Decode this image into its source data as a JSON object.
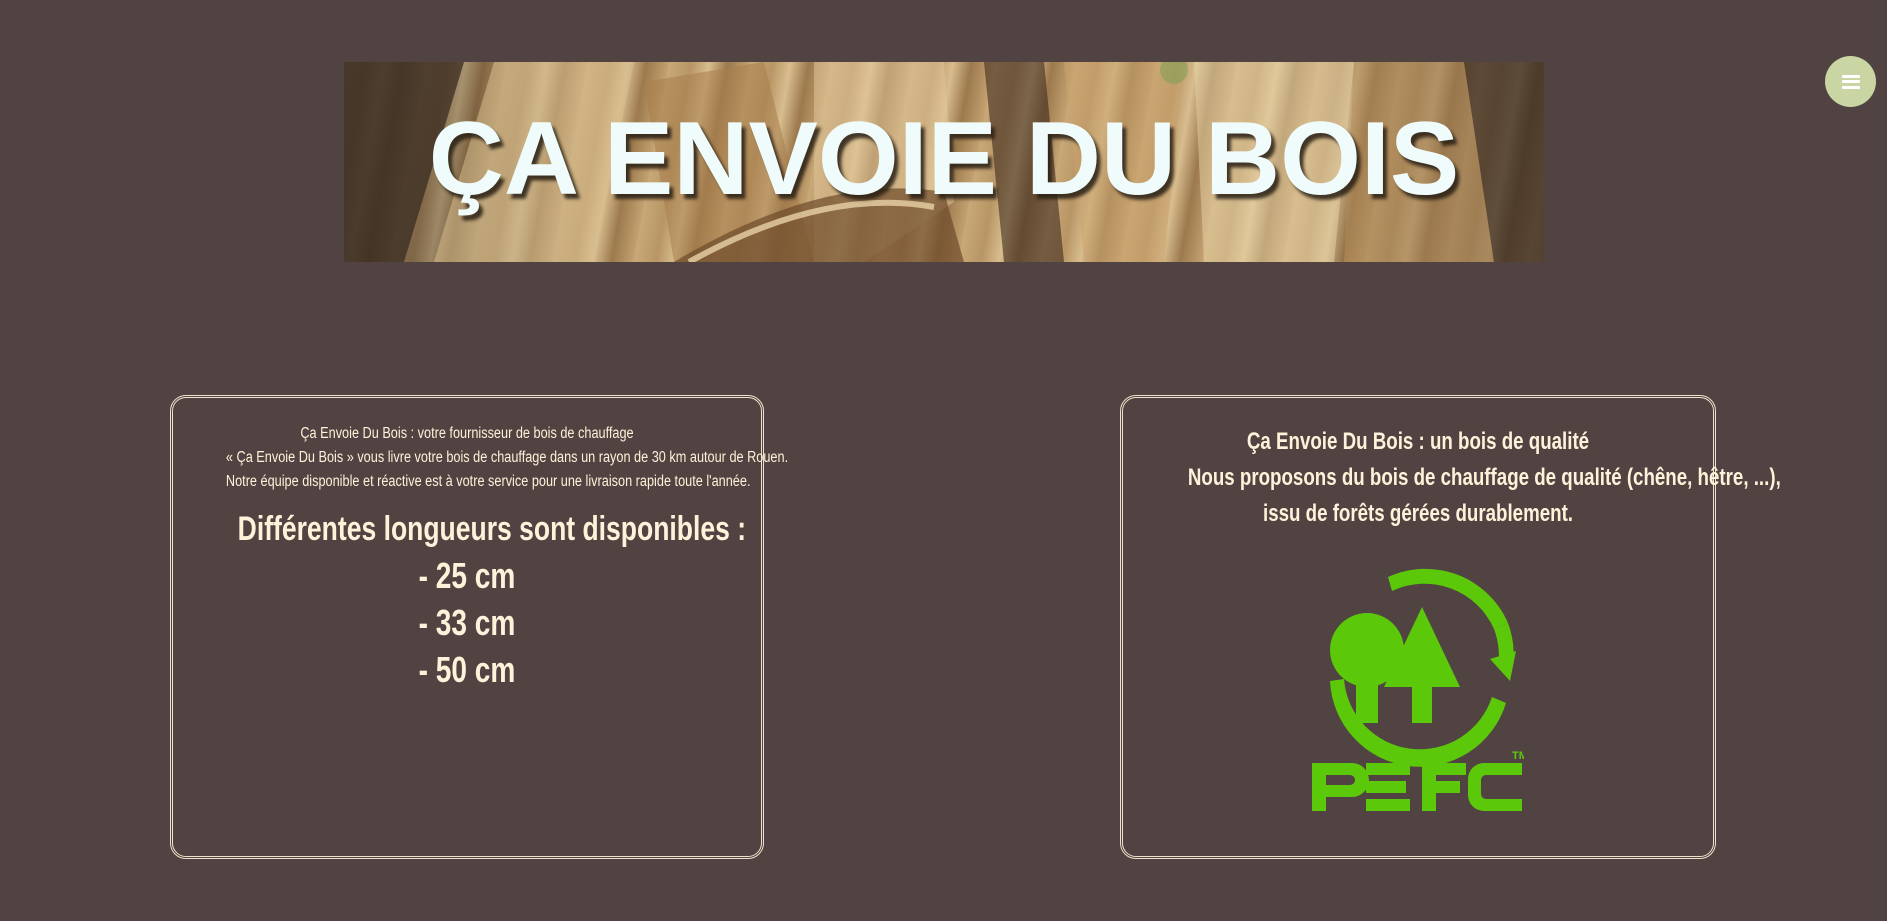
{
  "header": {
    "title": "ÇA ENVOIE DU BOIS",
    "menu_icon": "hamburger-icon"
  },
  "card_left": {
    "lines": [
      "Ça Envoie Du Bois : votre fournisseur de bois de chauffage",
      "« Ça Envoie Du Bois » vous livre votre bois de chauffage dans un rayon de 30 km autour de Rouen.",
      "Notre équipe disponible et réactive est à votre service pour une livraison rapide toute l'année."
    ],
    "lengths_heading": "Différentes longueurs sont disponibles :",
    "lengths": [
      "- 25 cm",
      "- 33 cm",
      "- 50 cm"
    ]
  },
  "card_right": {
    "lines": [
      "Ça Envoie Du Bois : un bois de qualité",
      "Nous proposons du bois de chauffage de qualité (chêne, hêtre, ...),",
      "issu de forêts gérées durablement."
    ],
    "logo": {
      "text": "PEFC",
      "tm": "TM",
      "color": "#5cc80a"
    }
  },
  "colors": {
    "background": "#514341",
    "text": "#fdf3da",
    "border": "#ede2cc",
    "menu_button": "#c9d6a4",
    "title": "#effcfb"
  }
}
